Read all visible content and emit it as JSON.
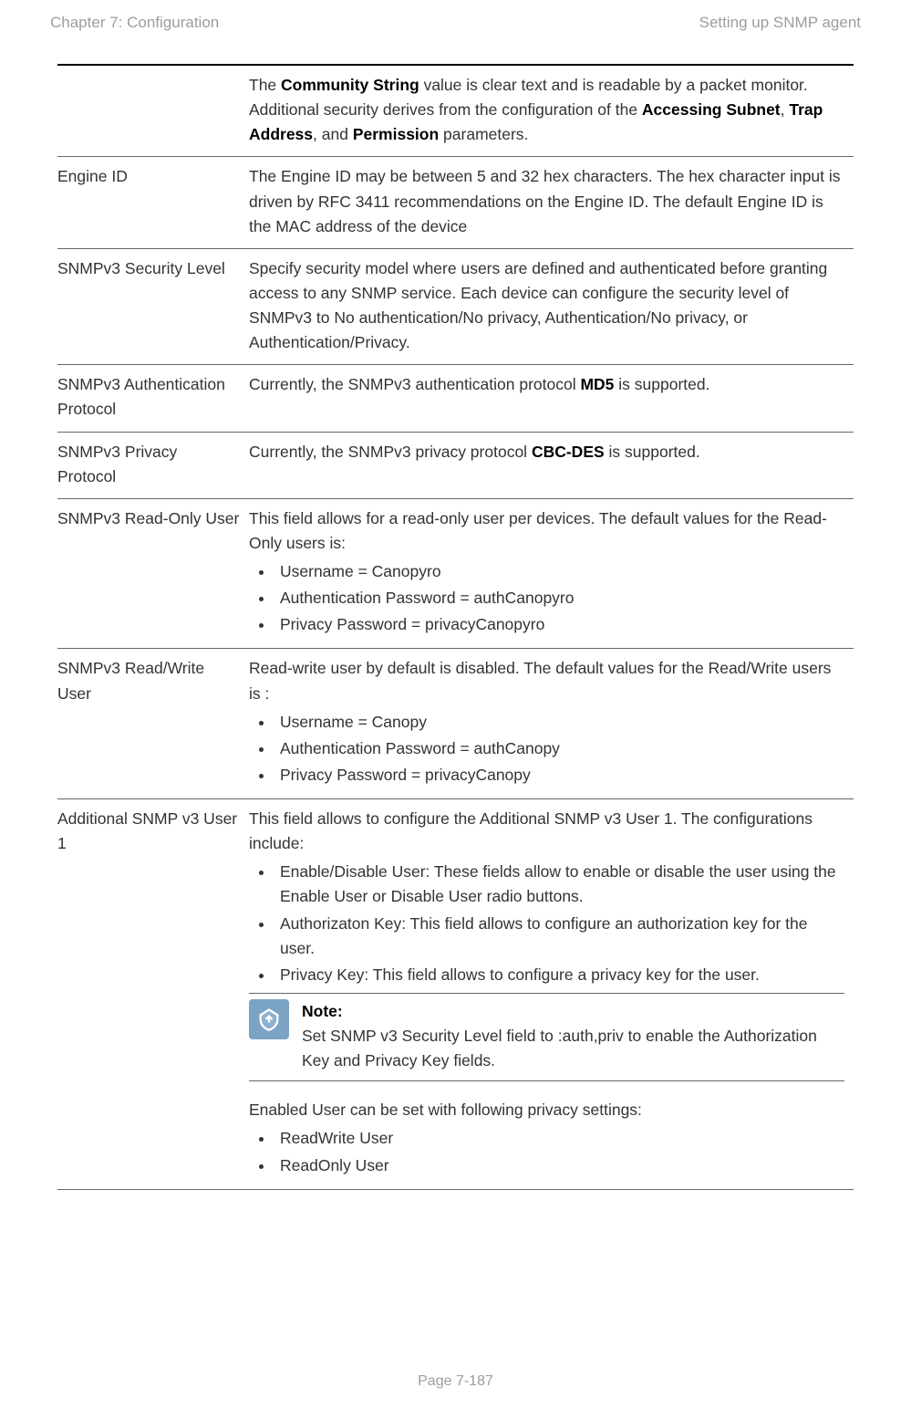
{
  "header": {
    "left": "Chapter 7:  Configuration",
    "right": "Setting up SNMP agent"
  },
  "rows": {
    "community": {
      "p1a": "The ",
      "p1b": "Community String",
      "p1c": " value is clear text and is readable by a packet monitor. Additional security derives from the configuration of the ",
      "p1d": "Accessing Subnet",
      "p1e": ", ",
      "p1f": "Trap Address",
      "p1g": ", and ",
      "p1h": "Permission",
      "p1i": " parameters."
    },
    "engine": {
      "attr": "Engine ID",
      "desc": "The Engine ID may be between 5 and 32 hex characters. The hex character input is driven by RFC 3411 recommendations on the Engine ID. The default Engine ID is the MAC address of the device"
    },
    "seclevel": {
      "attr": "SNMPv3 Security Level",
      "desc": "Specify security model where users are defined and authenticated before granting access to any SNMP service. Each device can configure the security level of SNMPv3 to No authentication/No privacy, Authentication/No privacy, or Authentication/Privacy."
    },
    "authproto": {
      "attr": "SNMPv3 Authentication Protocol",
      "d1": "Currently, the SNMPv3 authentication protocol ",
      "d2": "MD5",
      "d3": " is supported."
    },
    "privproto": {
      "attr": "SNMPv3 Privacy Protocol",
      "d1": "Currently, the SNMPv3 privacy protocol ",
      "d2": "CBC-DES",
      "d3": " is supported."
    },
    "rouser": {
      "attr": "SNMPv3 Read-Only User",
      "intro": "This field allows for a read-only user per devices. The default values for the Read-Only users is:",
      "b1": "Username = Canopyro",
      "b2": "Authentication Password = authCanopyro",
      "b3": "Privacy Password = privacyCanopyro"
    },
    "rwuser": {
      "attr": "SNMPv3 Read/Write User",
      "intro": "Read-write user by default is disabled. The default values for the Read/Write users is :",
      "b1": "Username = Canopy",
      "b2": "Authentication Password = authCanopy",
      "b3": "Privacy Password = privacyCanopy"
    },
    "adduser": {
      "attr": "Additional SNMP v3 User 1",
      "intro": "This field allows to configure the Additional SNMP v3 User 1. The configurations include:",
      "b1": "Enable/Disable User: These fields allow to enable or disable the user using the Enable User or Disable User radio buttons.",
      "b2": "Authorizaton Key: This field allows to configure an authorization key for the user.",
      "b3": "Privacy Key: This field allows to configure a privacy key for the user.",
      "note_label": "Note:",
      "note_text": "Set SNMP v3 Security Level field to :auth,priv to enable the Authorization Key and Privacy Key fields.",
      "post": "Enabled User can be set with following privacy settings:",
      "pb1": "ReadWrite User",
      "pb2": "ReadOnly User"
    }
  },
  "footer": "Page 7-187"
}
